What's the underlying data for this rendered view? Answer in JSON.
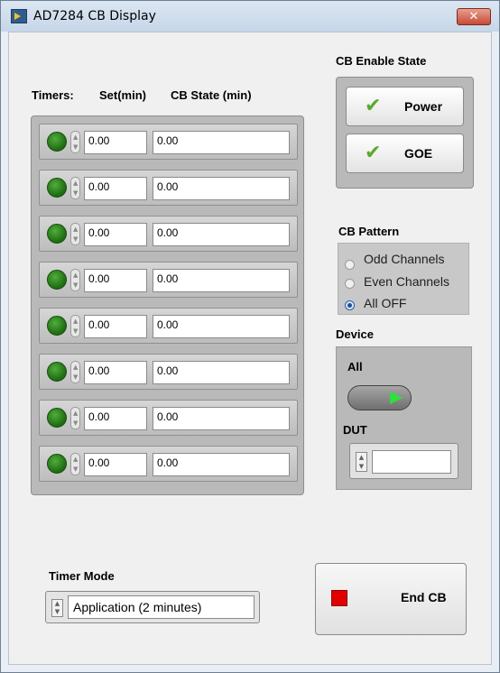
{
  "window": {
    "title": "AD7284 CB Display",
    "close_label": "✕"
  },
  "timers": {
    "label": "Timers:",
    "set_header": "Set(min)",
    "state_header": "CB State (min)",
    "rows": [
      {
        "set": "0.00",
        "state": "0.00",
        "led": "on"
      },
      {
        "set": "0.00",
        "state": "0.00",
        "led": "on"
      },
      {
        "set": "0.00",
        "state": "0.00",
        "led": "on"
      },
      {
        "set": "0.00",
        "state": "0.00",
        "led": "on"
      },
      {
        "set": "0.00",
        "state": "0.00",
        "led": "on"
      },
      {
        "set": "0.00",
        "state": "0.00",
        "led": "on"
      },
      {
        "set": "0.00",
        "state": "0.00",
        "led": "on"
      },
      {
        "set": "0.00",
        "state": "0.00",
        "led": "on"
      }
    ]
  },
  "cb_enable": {
    "label": "CB Enable State",
    "power_label": "Power",
    "goe_label": "GOE",
    "check_icon": "✔"
  },
  "cb_pattern": {
    "label": "CB Pattern",
    "options": [
      "Odd Channels",
      "Even Channels",
      "All OFF"
    ],
    "selected": "All OFF"
  },
  "device": {
    "label": "Device",
    "all_label": "All",
    "dut_label": "DUT",
    "dut_value": ""
  },
  "timer_mode": {
    "label": "Timer Mode",
    "value": "Application (2 minutes)"
  },
  "end_cb": {
    "label": "End CB"
  },
  "colors": {
    "led_green": "#1e6a12",
    "toggle_arrow": "#2ee03c",
    "stop_red": "#e00000"
  }
}
